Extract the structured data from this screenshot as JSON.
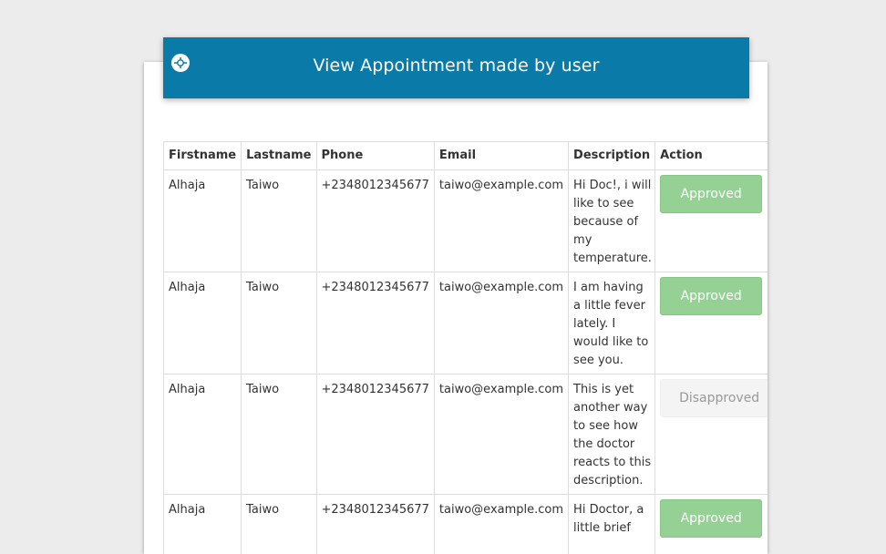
{
  "header": {
    "title": "View Appointment made by user",
    "icon": "logo-icon",
    "color": "#0a7aa9"
  },
  "table": {
    "columns": [
      "Firstname",
      "Lastname",
      "Phone",
      "Email",
      "Description",
      "Action"
    ],
    "rows": [
      {
        "firstname": "Alhaja",
        "lastname": "Taiwo",
        "phone": "+2348012345677",
        "email": "taiwo@example.com",
        "description": "Hi Doc!, i will like to see because of my temperature.",
        "action": "Approved"
      },
      {
        "firstname": "Alhaja",
        "lastname": "Taiwo",
        "phone": "+2348012345677",
        "email": "taiwo@example.com",
        "description": "I am having a little fever lately. I would like to see you.",
        "action": "Approved"
      },
      {
        "firstname": "Alhaja",
        "lastname": "Taiwo",
        "phone": "+2348012345677",
        "email": "taiwo@example.com",
        "description": "This is yet another way to see how the doctor reacts to this description.",
        "action": "Disapproved"
      },
      {
        "firstname": "Alhaja",
        "lastname": "Taiwo",
        "phone": "+2348012345677",
        "email": "taiwo@example.com",
        "description": "Hi Doctor, a little brief",
        "action": "Approved"
      }
    ]
  },
  "colors": {
    "approved": "#95d095",
    "disapproved": "#f4f4f4",
    "header": "#0a7aa9"
  }
}
